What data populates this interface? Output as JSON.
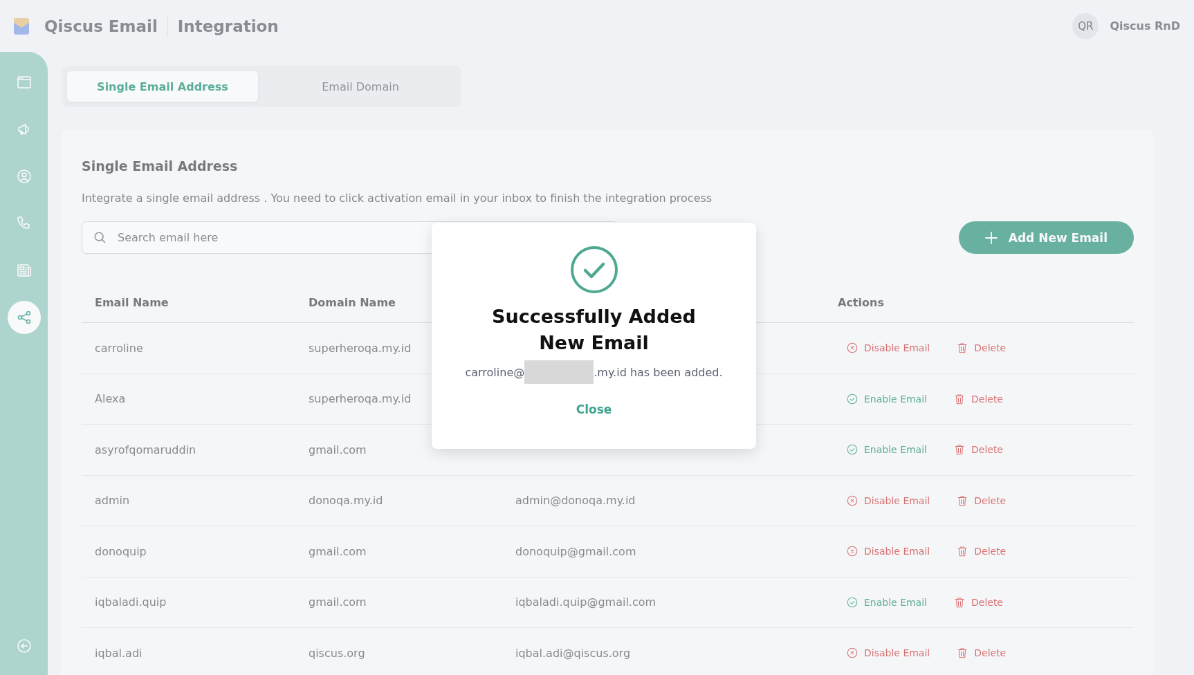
{
  "header": {
    "app_name": "Qiscus Email",
    "page_title": "Integration",
    "avatar_initials": "QR",
    "account_name": "Qiscus RnD"
  },
  "sidebar": {
    "items": [
      {
        "selected": false
      },
      {
        "selected": false
      },
      {
        "selected": false
      },
      {
        "selected": false
      },
      {
        "selected": false
      },
      {
        "selected": true
      }
    ]
  },
  "tabs": [
    {
      "label": "Single Email Address",
      "selected": true
    },
    {
      "label": "Email Domain",
      "selected": false
    }
  ],
  "section": {
    "title": "Single Email Address",
    "description": "Integrate a single email address . You need to click activation email in your inbox to finish the integration process",
    "search": {
      "placeholder": "Search email here"
    },
    "add_button": "Add New Email"
  },
  "table": {
    "columns": [
      "Email Name",
      "Domain Name",
      "",
      "Actions"
    ],
    "rows": [
      {
        "email_name": "carroline",
        "domain": "superheroqa.my.id",
        "column_3": null,
        "action": {
          "kind": "disable",
          "label": "Disable Email"
        },
        "delete": "Delete"
      },
      {
        "email_name": "Alexa",
        "domain": "superheroqa.my.id",
        "column_3": null,
        "action": {
          "kind": "enable",
          "label": "Enable Email"
        },
        "delete": "Delete"
      },
      {
        "email_name": "asyrofqomaruddin",
        "domain": "gmail.com",
        "column_3": null,
        "action": {
          "kind": "enable",
          "label": "Enable Email"
        },
        "delete": "Delete"
      },
      {
        "email_name": "admin",
        "domain": "donoqa.my.id",
        "column_3": "admin@donoqa.my.id",
        "action": {
          "kind": "disable",
          "label": "Disable Email"
        },
        "delete": "Delete"
      },
      {
        "email_name": "donoquip",
        "domain": "gmail.com",
        "column_3": "donoquip@gmail.com",
        "action": {
          "kind": "disable",
          "label": "Disable Email"
        },
        "delete": "Delete"
      },
      {
        "email_name": "iqbaladi.quip",
        "domain": "gmail.com",
        "column_3": "iqbaladi.quip@gmail.com",
        "action": {
          "kind": "enable",
          "label": "Enable Email"
        },
        "delete": "Delete"
      },
      {
        "email_name": "iqbal.adi",
        "domain": "qiscus.org",
        "column_3": "iqbal.adi@qiscus.org",
        "action": {
          "kind": "disable",
          "label": "Disable Email"
        },
        "delete": "Delete"
      }
    ]
  },
  "dialog": {
    "title_lines": [
      "Successfully Added",
      "New Email"
    ],
    "message_before": "carroline@",
    "message_after": ".my.id has been added.",
    "close_button": "Close"
  }
}
